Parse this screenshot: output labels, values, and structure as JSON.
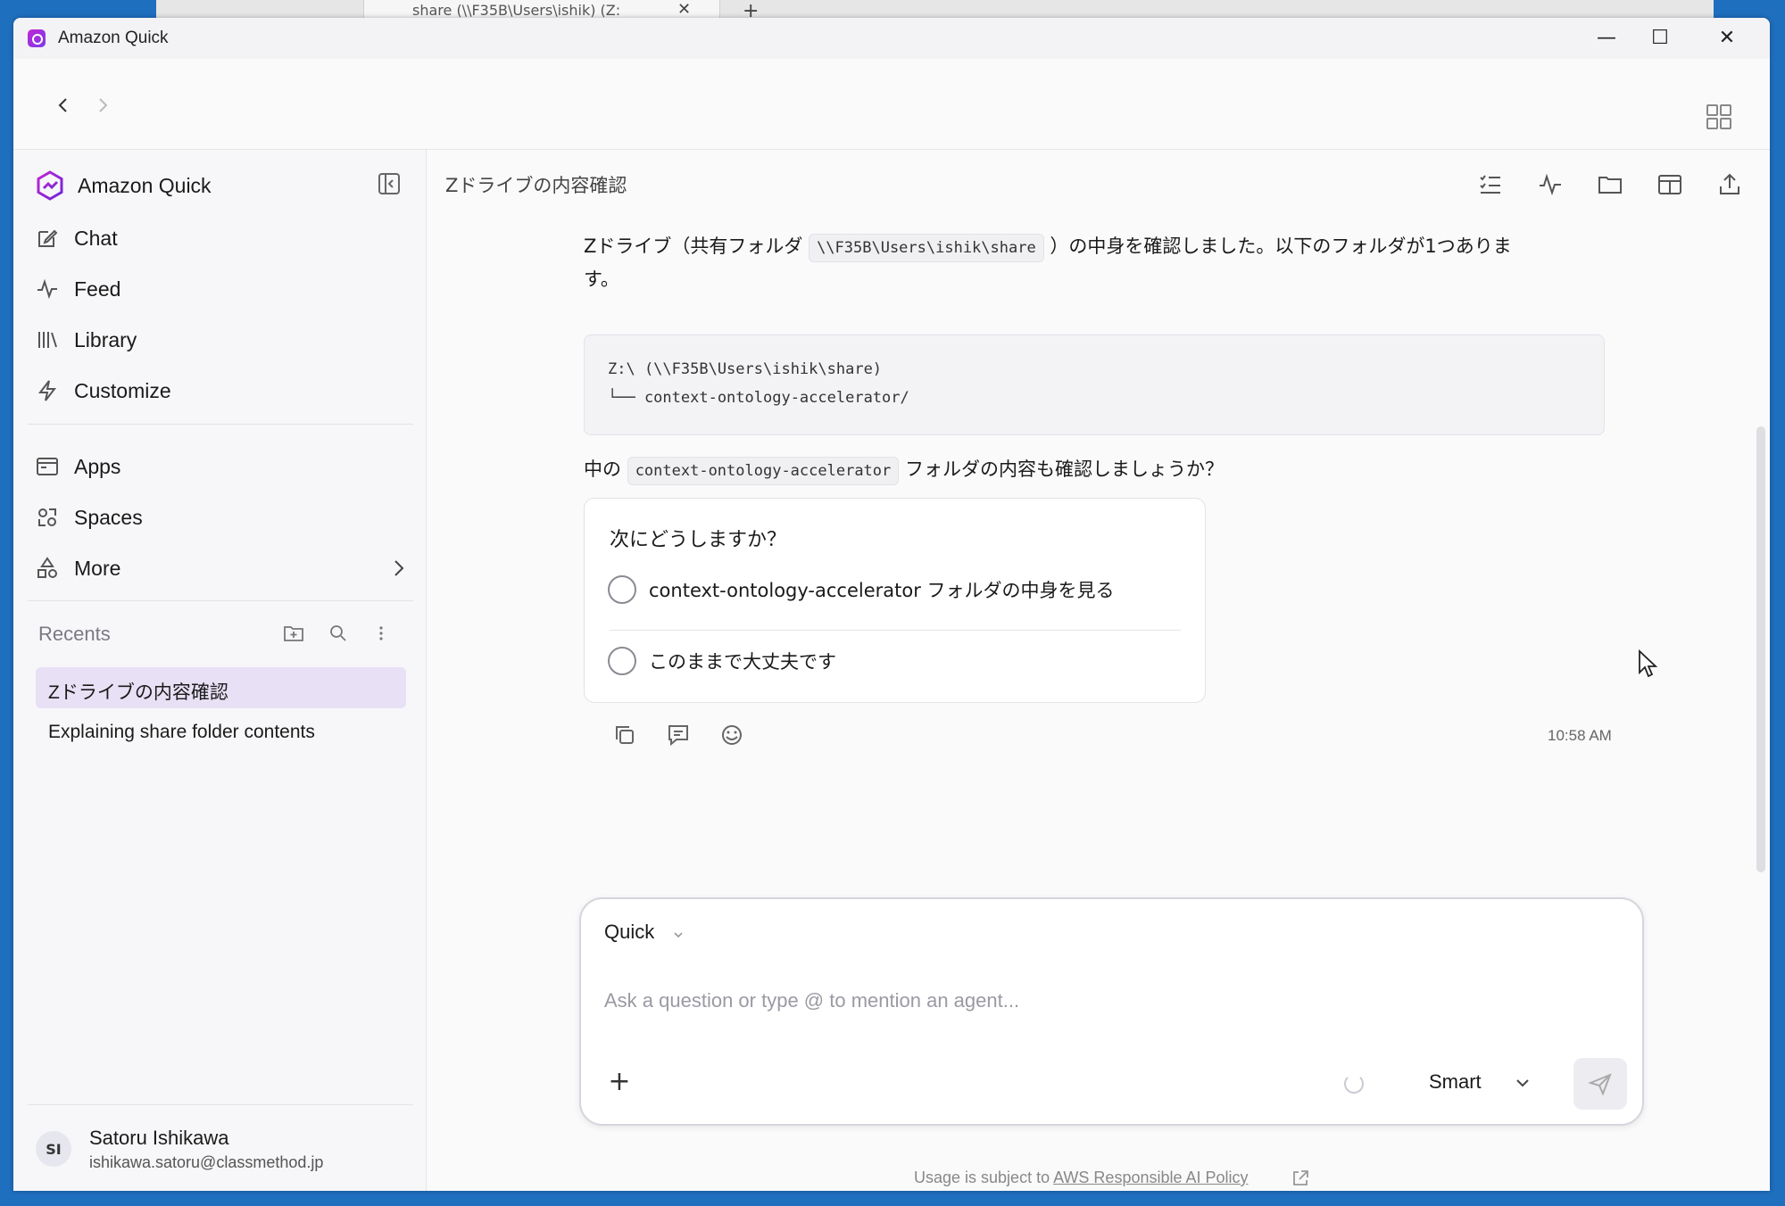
{
  "background_window": {
    "tab_title": "share (\\\\F35B\\Users\\ishik) (Z:",
    "tab_close": "✕",
    "new_tab": "+"
  },
  "titlebar": {
    "title": "Amazon Quick",
    "minimize": "—",
    "maximize": "☐",
    "close": "✕"
  },
  "sidebar": {
    "brand": "Amazon Quick",
    "nav": {
      "chat": "Chat",
      "feed": "Feed",
      "library": "Library",
      "customize": "Customize",
      "apps": "Apps",
      "spaces": "Spaces",
      "more": "More"
    },
    "recents_title": "Recents",
    "recents": [
      "Zドライブの内容確認",
      "Explaining share folder contents"
    ],
    "user": {
      "initials": "SI",
      "name": "Satoru Ishikawa",
      "email": "ishikawa.satoru@classmethod.jp"
    }
  },
  "main": {
    "title": "Zドライブの内容確認",
    "message": {
      "line1_before": "Zドライブ（共有フォルダ ",
      "line1_code": "\\\\F35B\\Users\\ishik\\share",
      "line1_after": " ）の中身を確認しました。以下のフォルダが1つありま",
      "line2": "す。",
      "code_block": "Z:\\ (\\\\F35B\\Users\\ishik\\share)\n└── context-ontology-accelerator/",
      "line3_before": "中の ",
      "line3_code": "context-ontology-accelerator",
      "line3_after": " フォルダの内容も確認しましょうか？"
    },
    "choices": {
      "title": "次にどうしますか？",
      "options": [
        "context-ontology-accelerator フォルダの中身を見る",
        "このままで大丈夫です"
      ]
    },
    "timestamp": "10:58 AM"
  },
  "composer": {
    "agent": "Quick",
    "placeholder": "Ask a question or type @ to mention an agent...",
    "add_label": "+",
    "mode": "Smart"
  },
  "footer": {
    "prefix": "Usage is subject to ",
    "link": "AWS Responsible AI Policy"
  },
  "colors": {
    "accent": "#7c3aed",
    "active_recent": "#e8e0f5",
    "desktop": "#1f6fbf"
  }
}
